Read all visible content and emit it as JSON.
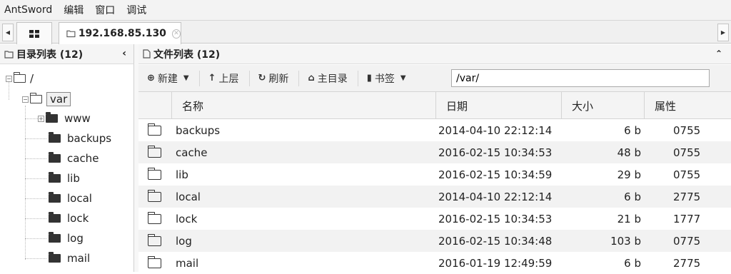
{
  "menu": {
    "app": "AntSword",
    "edit": "编辑",
    "window": "窗口",
    "debug": "调试"
  },
  "tabs": {
    "home_icon": "grid-icon",
    "host_label": "192.168.85.130"
  },
  "left_panel": {
    "title": "目录列表 (12)",
    "tree": {
      "root": "/",
      "var": "var",
      "children": [
        "www",
        "backups",
        "cache",
        "lib",
        "local",
        "lock",
        "log",
        "mail"
      ]
    }
  },
  "right_panel": {
    "title": "文件列表 (12)",
    "toolbar": {
      "new": "新建",
      "up": "上层",
      "refresh": "刷新",
      "home": "主目录",
      "bookmark": "书签",
      "path": "/var/"
    },
    "columns": {
      "name": "名称",
      "date": "日期",
      "size": "大小",
      "attr": "属性"
    },
    "rows": [
      {
        "name": "backups",
        "date": "2014-04-10 22:12:14",
        "size": "6 b",
        "attr": "0755"
      },
      {
        "name": "cache",
        "date": "2016-02-15 10:34:53",
        "size": "48 b",
        "attr": "0755"
      },
      {
        "name": "lib",
        "date": "2016-02-15 10:34:59",
        "size": "29 b",
        "attr": "0755"
      },
      {
        "name": "local",
        "date": "2014-04-10 22:12:14",
        "size": "6 b",
        "attr": "2775"
      },
      {
        "name": "lock",
        "date": "2016-02-15 10:34:53",
        "size": "21 b",
        "attr": "1777"
      },
      {
        "name": "log",
        "date": "2016-02-15 10:34:48",
        "size": "103 b",
        "attr": "0775"
      },
      {
        "name": "mail",
        "date": "2016-01-19 12:49:59",
        "size": "6 b",
        "attr": "2775"
      }
    ]
  }
}
